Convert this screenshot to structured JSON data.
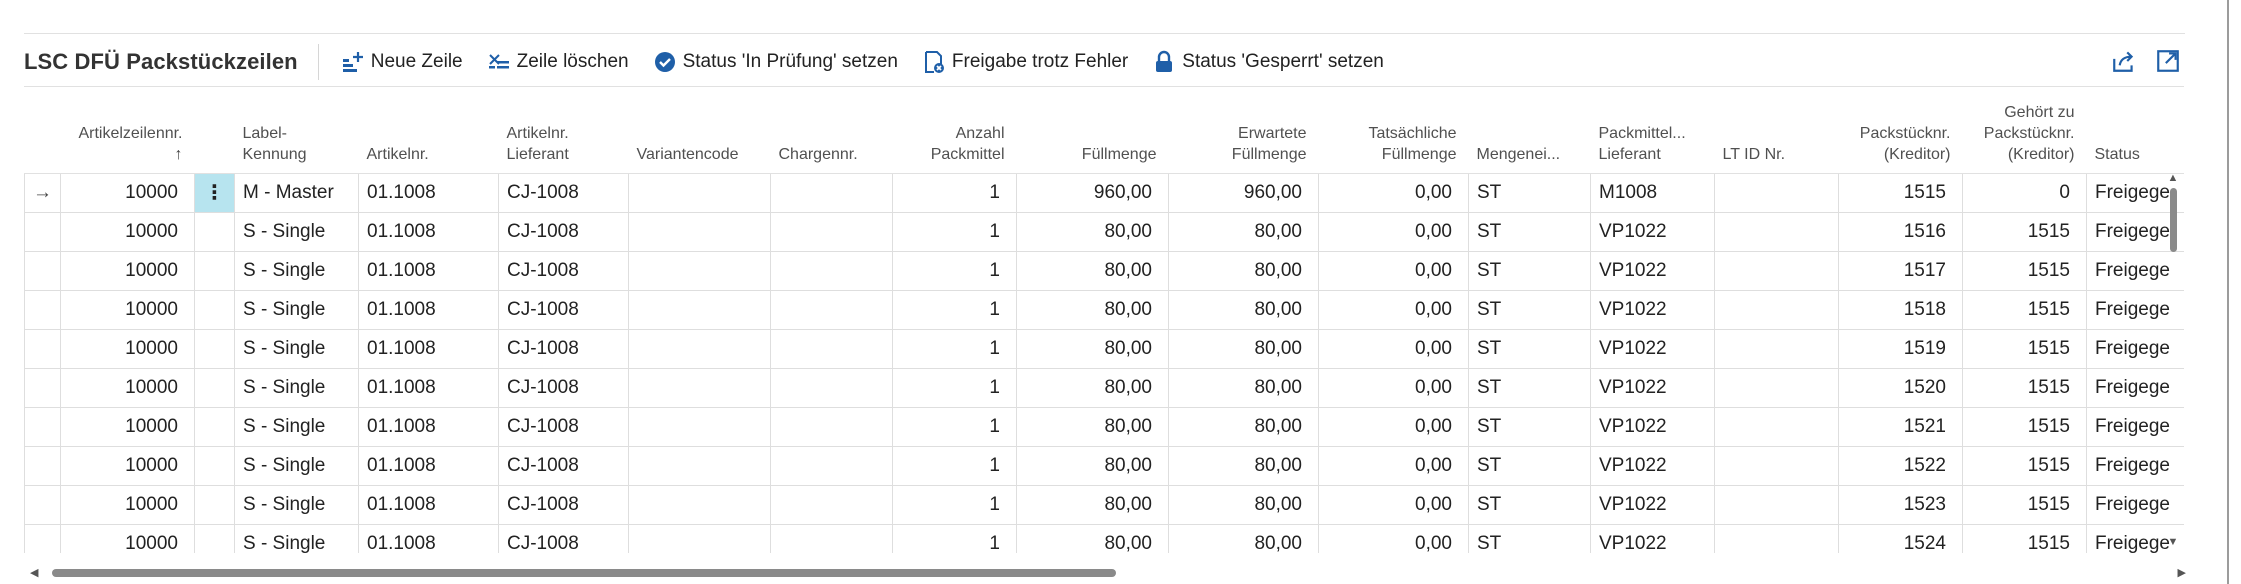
{
  "page": {
    "title": "LSC DFÜ Packstückzeilen"
  },
  "toolbar": {
    "actions": [
      {
        "label": "Neue Zeile",
        "icon": "new-line-icon"
      },
      {
        "label": "Zeile löschen",
        "icon": "delete-line-icon"
      },
      {
        "label": "Status 'In Prüfung' setzen",
        "icon": "check-badge-icon"
      },
      {
        "label": "Freigabe trotz Fehler",
        "icon": "release-error-icon"
      },
      {
        "label": "Status 'Gesperrt' setzen",
        "icon": "lock-icon"
      }
    ],
    "right_icons": [
      "share-icon",
      "expand-icon"
    ]
  },
  "colors": {
    "selected_cell": "#b7e4ef",
    "accent": "#0f6cbd",
    "grid_line": "#dedede"
  },
  "table": {
    "sort_indicator": "↑",
    "row_indicator": "→",
    "row_menu": "⋮",
    "columns": [
      {
        "key": "artikelzeilennr",
        "label": "Artikelzeilennr."
      },
      {
        "key": "label_kennung",
        "label": "Label-Kennung"
      },
      {
        "key": "artikelnr",
        "label": "Artikelnr."
      },
      {
        "key": "artikelnr_lieferant",
        "label": "Artikelnr. Lieferant"
      },
      {
        "key": "variantencode",
        "label": "Variantencode"
      },
      {
        "key": "chargennr",
        "label": "Chargennr."
      },
      {
        "key": "anzahl_packmittel",
        "label": "Anzahl Packmittel"
      },
      {
        "key": "fuellmenge",
        "label": "Füllmenge"
      },
      {
        "key": "erwartete_fuellmenge",
        "label": "Erwartete Füllmenge"
      },
      {
        "key": "tatsaechliche_fuellmenge",
        "label": "Tatsächliche Füllmenge"
      },
      {
        "key": "mengeneinheit",
        "label": "Mengenei..."
      },
      {
        "key": "packmittel_lieferant",
        "label": "Packmittel... Lieferant"
      },
      {
        "key": "lt_id_nr",
        "label": "LT ID Nr."
      },
      {
        "key": "packstuecknr_kreditor",
        "label": "Packstücknr. (Kreditor)"
      },
      {
        "key": "gehoert_zu",
        "label": "Gehört zu Packstücknr. (Kreditor)"
      },
      {
        "key": "status",
        "label": "Status"
      }
    ],
    "rows": [
      [
        "10000",
        "M - Master",
        "01.1008",
        "CJ-1008",
        "",
        "",
        "1",
        "960,00",
        "960,00",
        "0,00",
        "ST",
        "M1008",
        "",
        "1515",
        "0",
        "Freigege"
      ],
      [
        "10000",
        "S - Single",
        "01.1008",
        "CJ-1008",
        "",
        "",
        "1",
        "80,00",
        "80,00",
        "0,00",
        "ST",
        "VP1022",
        "",
        "1516",
        "1515",
        "Freigege"
      ],
      [
        "10000",
        "S - Single",
        "01.1008",
        "CJ-1008",
        "",
        "",
        "1",
        "80,00",
        "80,00",
        "0,00",
        "ST",
        "VP1022",
        "",
        "1517",
        "1515",
        "Freigege"
      ],
      [
        "10000",
        "S - Single",
        "01.1008",
        "CJ-1008",
        "",
        "",
        "1",
        "80,00",
        "80,00",
        "0,00",
        "ST",
        "VP1022",
        "",
        "1518",
        "1515",
        "Freigege"
      ],
      [
        "10000",
        "S - Single",
        "01.1008",
        "CJ-1008",
        "",
        "",
        "1",
        "80,00",
        "80,00",
        "0,00",
        "ST",
        "VP1022",
        "",
        "1519",
        "1515",
        "Freigege"
      ],
      [
        "10000",
        "S - Single",
        "01.1008",
        "CJ-1008",
        "",
        "",
        "1",
        "80,00",
        "80,00",
        "0,00",
        "ST",
        "VP1022",
        "",
        "1520",
        "1515",
        "Freigege"
      ],
      [
        "10000",
        "S - Single",
        "01.1008",
        "CJ-1008",
        "",
        "",
        "1",
        "80,00",
        "80,00",
        "0,00",
        "ST",
        "VP1022",
        "",
        "1521",
        "1515",
        "Freigege"
      ],
      [
        "10000",
        "S - Single",
        "01.1008",
        "CJ-1008",
        "",
        "",
        "1",
        "80,00",
        "80,00",
        "0,00",
        "ST",
        "VP1022",
        "",
        "1522",
        "1515",
        "Freigege"
      ],
      [
        "10000",
        "S - Single",
        "01.1008",
        "CJ-1008",
        "",
        "",
        "1",
        "80,00",
        "80,00",
        "0,00",
        "ST",
        "VP1022",
        "",
        "1523",
        "1515",
        "Freigege"
      ],
      [
        "10000",
        "S - Single",
        "01.1008",
        "CJ-1008",
        "",
        "",
        "1",
        "80,00",
        "80,00",
        "0,00",
        "ST",
        "VP1022",
        "",
        "1524",
        "1515",
        "Freigege"
      ]
    ]
  }
}
